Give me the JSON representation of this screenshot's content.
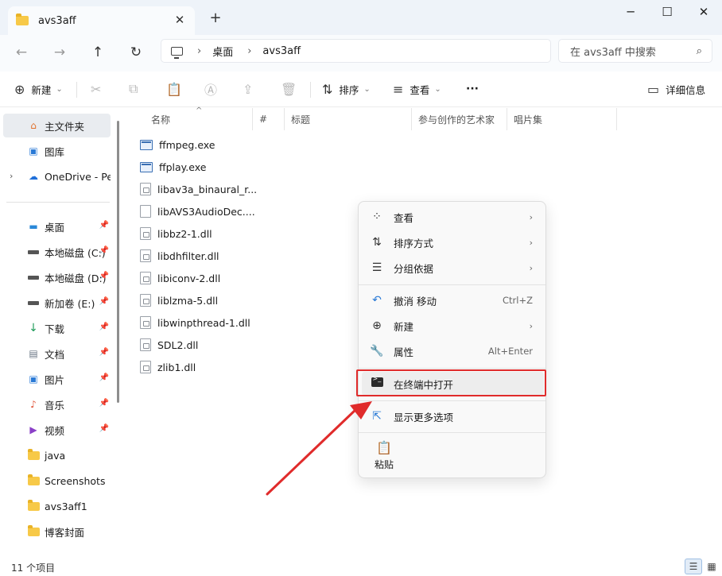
{
  "tabbar": {
    "tab_title": "avs3aff",
    "close_glyph": "✕",
    "new_tab_glyph": "+",
    "minimize_glyph": "─",
    "maximize_glyph": "☐",
    "window_close_glyph": "✕"
  },
  "nav": {
    "back_icon": "←",
    "forward_icon": "→",
    "up_icon": "↑",
    "refresh_icon": "↻",
    "breadcrumb": [
      "桌面",
      "avs3aff"
    ],
    "breadcrumb_sep": "›",
    "search_placeholder": "在 avs3aff 中搜索",
    "search_icon": "⌕"
  },
  "toolbar": {
    "new_label": "新建",
    "new_icon": "⊕",
    "cut_icon": "✂",
    "copy_icon": "⧉",
    "paste_icon": "📋",
    "rename_icon": "Ⓐ",
    "share_icon": "⇪",
    "delete_icon": "🗑",
    "sort_label": "排序",
    "sort_icon": "⇅",
    "view_label": "查看",
    "view_icon": "≡",
    "more_label": "···",
    "details_label": "详细信息",
    "details_icon": "▭",
    "chevron": "⌄"
  },
  "sidebar": {
    "items": [
      {
        "label": "主文件夹"
      },
      {
        "label": "图库"
      },
      {
        "label": "OneDrive - Personal"
      },
      {
        "label": "桌面"
      },
      {
        "label": "本地磁盘 (C:)"
      },
      {
        "label": "本地磁盘 (D:)"
      },
      {
        "label": "新加卷 (E:)"
      },
      {
        "label": "下载"
      },
      {
        "label": "文档"
      },
      {
        "label": "图片"
      },
      {
        "label": "音乐"
      },
      {
        "label": "视频"
      },
      {
        "label": "java"
      },
      {
        "label": "Screenshots"
      },
      {
        "label": "avs3aff1"
      },
      {
        "label": "博客封面"
      }
    ],
    "pin_glyph": "📌",
    "expander_glyph": "›"
  },
  "columns": {
    "name": "名称",
    "number": "#",
    "title": "标题",
    "artist": "参与创作的艺术家",
    "album": "唱片集",
    "sort_glyph": "^"
  },
  "files": [
    {
      "name": "ffmpeg.exe"
    },
    {
      "name": "ffplay.exe"
    },
    {
      "name": "libav3a_binaural_r..."
    },
    {
      "name": "libAVS3AudioDec...."
    },
    {
      "name": "libbz2-1.dll"
    },
    {
      "name": "libdhfilter.dll"
    },
    {
      "name": "libiconv-2.dll"
    },
    {
      "name": "liblzma-5.dll"
    },
    {
      "name": "libwinpthread-1.dll"
    },
    {
      "name": "SDL2.dll"
    },
    {
      "name": "zlib1.dll"
    }
  ],
  "context_menu": {
    "view": "查看",
    "sort_by": "排序方式",
    "group_by": "分组依据",
    "undo": "撤消 移动",
    "undo_shortcut": "Ctrl+Z",
    "new": "新建",
    "properties": "属性",
    "properties_shortcut": "Alt+Enter",
    "open_in_terminal": "在终端中打开",
    "show_more": "显示更多选项",
    "paste": "粘贴",
    "submenu_glyph": "›",
    "view_icon": "⁘",
    "sort_icon": "⇅",
    "group_icon": "☰",
    "undo_icon": "↶",
    "new_icon": "⊕",
    "properties_icon": "🔧",
    "show_more_icon": "⇱",
    "paste_icon": "📋"
  },
  "annotation": {
    "highlight_color": "#e02b2b",
    "arrow_color": "#e02b2b"
  },
  "status": {
    "item_count": "11 个项目",
    "details_view_icon": "☰",
    "tiles_view_icon": "▦"
  }
}
